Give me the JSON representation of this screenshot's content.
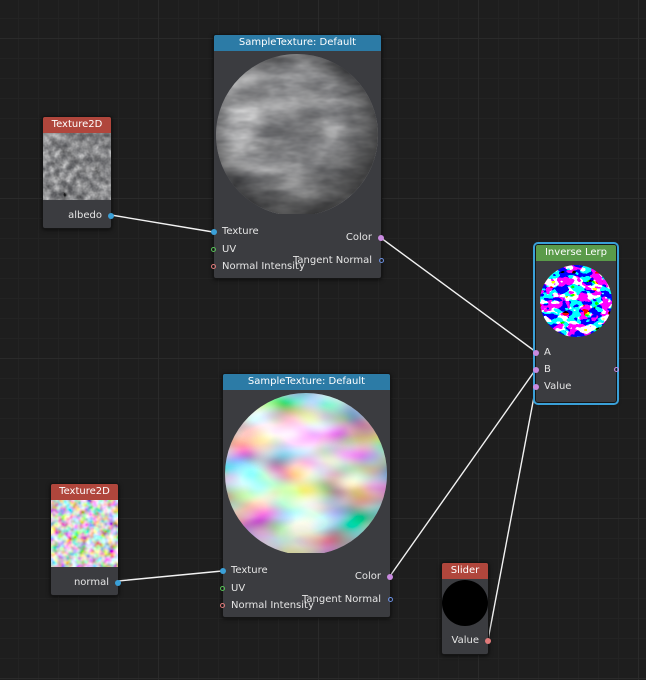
{
  "sample_top": {
    "title": "SampleTexture: Default",
    "inputs": [
      "Texture",
      "UV",
      "Normal Intensity"
    ],
    "outputs": [
      "Color",
      "Tangent Normal"
    ]
  },
  "sample_bottom": {
    "title": "SampleTexture: Default",
    "inputs": [
      "Texture",
      "UV",
      "Normal Intensity"
    ],
    "outputs": [
      "Color",
      "Tangent Normal"
    ]
  },
  "tex_albedo": {
    "title": "Texture2D",
    "output": "albedo"
  },
  "tex_normal": {
    "title": "Texture2D",
    "output": "normal"
  },
  "inverse_lerp": {
    "title": "Inverse Lerp",
    "inputs": [
      "A",
      "B",
      "Value"
    ]
  },
  "slider": {
    "title": "Slider",
    "output": "Value"
  },
  "colors": {
    "background": "#1e1e1e",
    "node_body": "#3b3c40",
    "sample_header": "#2c7ba6",
    "texture_header": "#b0463c",
    "lerp_header": "#5a9b4a",
    "selection": "#3aa0d8",
    "port_texture": "#3aa0d8",
    "port_uv": "#57c257",
    "port_float": "#e07a7a",
    "port_color": "#c98ae0"
  }
}
